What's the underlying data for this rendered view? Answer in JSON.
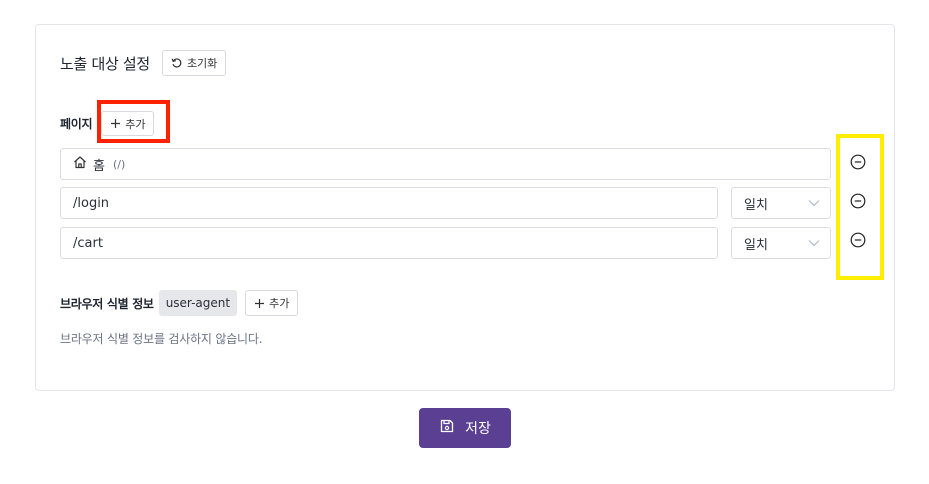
{
  "header": {
    "title": "노출 대상 설정",
    "reset_label": "초기화"
  },
  "pages": {
    "label": "페이지",
    "add_label": "추가",
    "home": {
      "name": "홈",
      "path": "(/)"
    },
    "rows": [
      {
        "value": "/login",
        "match": "일치"
      },
      {
        "value": "/cart",
        "match": "일치"
      }
    ]
  },
  "browser": {
    "label": "브라우저 식별 정보",
    "tag": "user-agent",
    "add_label": "추가",
    "hint": "브라우저 식별 정보를 검사하지 않습니다."
  },
  "footer": {
    "save_label": "저장"
  },
  "colors": {
    "primary": "#5b3f93",
    "highlight_red": "#ff2200",
    "highlight_yellow": "#ffee00"
  },
  "icons": [
    "reset-icon",
    "plus-icon",
    "home-icon",
    "chevron-down-icon",
    "minus-circle-icon",
    "save-icon"
  ]
}
